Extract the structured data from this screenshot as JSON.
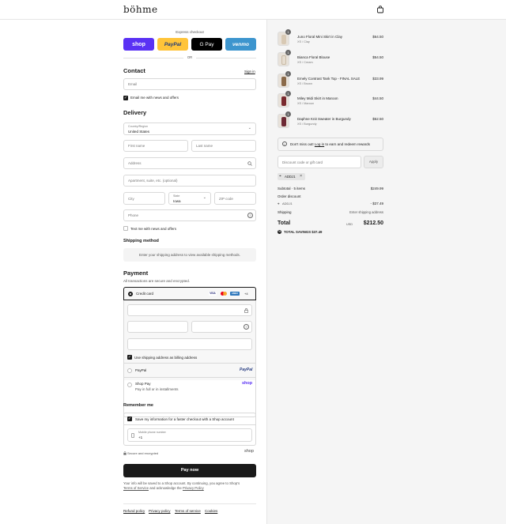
{
  "brand": "böhme",
  "colors": {
    "shop": "#5a31f4",
    "paypal_yellow": "#ffc439",
    "venmo": "#3d95ce",
    "dark": "#1a1a1a"
  },
  "express": {
    "title": "Express checkout",
    "shop": "shop",
    "paypal": "PayPal",
    "gpay": "G Pay",
    "venmo": "venmo",
    "or": "OR"
  },
  "contact": {
    "title": "Contact",
    "sign_in": "Sign in",
    "email_placeholder": "Email",
    "newsletter": "Email me with news and offers"
  },
  "delivery": {
    "title": "Delivery",
    "country_label": "Country/Region",
    "country_value": "United States",
    "first_name": "First name",
    "last_name": "Last name",
    "address": "Address",
    "apartment": "Apartment, suite, etc. (optional)",
    "city": "City",
    "state_label": "State",
    "state_value": "Iowa",
    "zip": "ZIP code",
    "phone": "Phone",
    "text_me": "Text me with news and offers"
  },
  "shipping": {
    "title": "Shipping method",
    "info": "Enter your shipping address to view available shipping methods."
  },
  "payment": {
    "title": "Payment",
    "subtitle": "All transactions are secure and encrypted.",
    "credit_card": "Credit card",
    "cards": [
      "VISA",
      "MC",
      "AMEX"
    ],
    "more_cards": "+4",
    "billing_same": "Use shipping address as billing address",
    "paypal": "PayPal",
    "paypal_logo": "PayPal",
    "shop_pay": "Shop Pay",
    "shop_pay_sub": "Pay in full or in installments",
    "shop_logo": "shop"
  },
  "remember": {
    "title": "Remember me",
    "save_info": "Save my information for a faster checkout with a Shop account",
    "mobile_label": "Mobile phone number",
    "mobile_value": "+1",
    "secure": "Secure and encrypted",
    "shop_logo": "shop"
  },
  "pay_now": "Pay now",
  "disclaimer_1": "Your info will be saved to a Shop account. By continuing, you agree to Shop's",
  "terms": "Terms of Service",
  "and_ack": "and acknowledge the",
  "privacy": "Privacy Policy",
  "footer": [
    "Refund policy",
    "Privacy policy",
    "Terms of service",
    "Cookies"
  ],
  "cart": {
    "items": [
      {
        "name": "Juno Floral Mini Skirt in Clay",
        "variant": "XS / Clay",
        "price": "$64.50",
        "qty": "1",
        "color": "#d8c9b4"
      },
      {
        "name": "Bianca Floral Blouse",
        "variant": "XS / Cream",
        "price": "$54.50",
        "qty": "1",
        "color": "#e6ddd0"
      },
      {
        "name": "Emely Contrast Tank Top - FINAL SALE",
        "variant": "XS / Brown",
        "price": "$33.99",
        "qty": "1",
        "color": "#8a6a4a"
      },
      {
        "name": "Miley Midi Skirt in Maroon",
        "variant": "XS / Maroon",
        "price": "$44.50",
        "qty": "1",
        "color": "#7a2a2f"
      },
      {
        "name": "Daphne Knit Sweater in Burgundy",
        "variant": "XS / Burgundy",
        "price": "$52.50",
        "qty": "1",
        "color": "#6e2a35"
      }
    ],
    "rewards_pre": "Don't miss out!",
    "rewards_link": "Log in",
    "rewards_post": "to earn and redeem rewards",
    "discount_placeholder": "Discount code or gift card",
    "apply": "Apply",
    "code": "ADDJ1",
    "subtotal_label": "Subtotal · 5 items",
    "subtotal_value": "$249.99",
    "order_discount": "Order discount",
    "discount_code": "ADDJ1",
    "discount_value": "- $37.49",
    "shipping_label": "Shipping",
    "shipping_value": "Enter shipping address",
    "total_label": "Total",
    "currency": "USD",
    "total_value": "$212.50",
    "savings_label": "TOTAL SAVINGS",
    "savings_value": "$37.49"
  }
}
